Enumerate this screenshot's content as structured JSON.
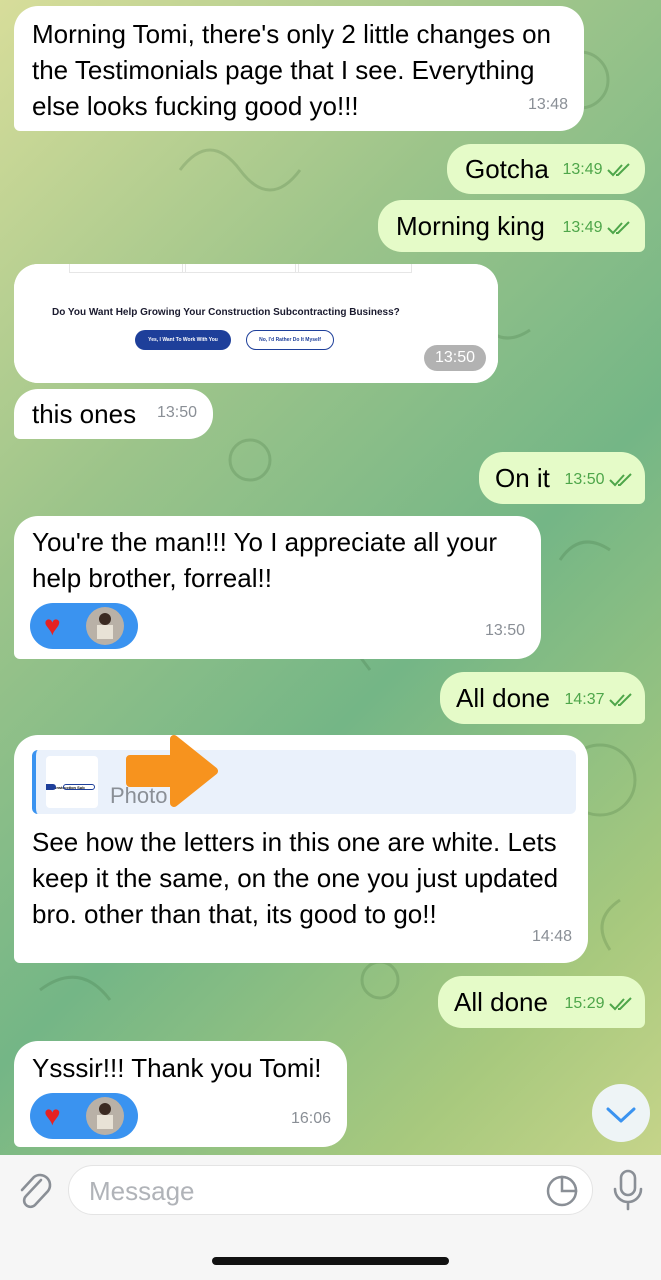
{
  "messages": [
    {
      "text": "Morning Tomi, there's only 2 little changes on the Testimonials page that I see. Everything else looks fucking good yo!!!",
      "time": "13:48"
    },
    {
      "text": "Gotcha",
      "time": "13:49"
    },
    {
      "text": "Morning king",
      "time": "13:49"
    },
    {
      "type": "screenshot",
      "headline": "Do You Want Help Growing Your Construction Subcontracting Business?",
      "btn_yes": "Yes, I Want To Work With You",
      "btn_no": "No, I'd Rather Do It Myself",
      "time": "13:50"
    },
    {
      "text": "this ones",
      "time": "13:50"
    },
    {
      "text": "On it",
      "time": "13:50"
    },
    {
      "text": "You're the man!!! Yo I appreciate all your help brother, forreal!!",
      "time": "13:50"
    },
    {
      "text": "All done",
      "time": "14:37"
    },
    {
      "text": "See how the letters in this one are white. Lets keep it the same, on the one you just updated bro. other than that, its good to go!!",
      "time": "14:48",
      "reply_label": "Photo",
      "reply_thumb_text": "ur Construction Sub"
    },
    {
      "text": "All done",
      "time": "15:29"
    },
    {
      "text": "Ysssir!!! Thank you Tomi!",
      "time": "16:06"
    }
  ],
  "composer": {
    "placeholder": "Message"
  },
  "colors": {
    "incoming": "#ffffff",
    "outgoing": "#e5fbc8",
    "accent": "#3a93f0",
    "arrow": "#f7931e"
  }
}
